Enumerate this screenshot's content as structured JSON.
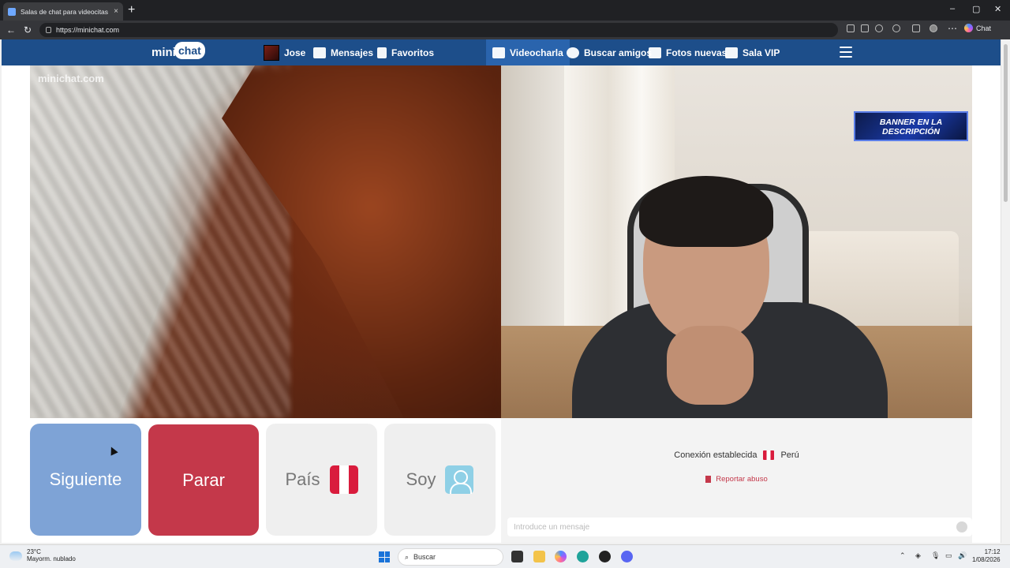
{
  "browser": {
    "tab_title": "Salas de chat para videocitas",
    "tab_close": "×",
    "new_tab": "+",
    "url": "https://minichat.com",
    "chat_button": "Chat",
    "window_controls": [
      "–",
      "▢",
      "✕"
    ]
  },
  "site": {
    "logo_mini": "mini",
    "logo_chat": "chat",
    "nav": {
      "user_name": "Jose",
      "messages": "Mensajes",
      "favorites": "Favoritos",
      "videochat": "Videocharla",
      "find_friends": "Buscar amigos",
      "new_photos": "Fotos nuevas",
      "vip_room": "Sala VIP"
    },
    "watermark": "minichat.com",
    "banner": "BANNER EN LA DESCRIPCIÓN"
  },
  "controls": {
    "next": "Siguiente",
    "stop": "Parar",
    "country": "País",
    "gender": "Soy"
  },
  "chat": {
    "status": "Conexión establecida",
    "country": "Perú",
    "report": "Reportar abuso",
    "message_placeholder": "Introduce un mensaje"
  },
  "taskbar": {
    "temperature": "23°C",
    "weather": "Mayorm. nublado",
    "search": "Buscar",
    "time": "17:12",
    "date": "1/08/2026"
  },
  "colors": {
    "nav_bg": "#1d4e8a",
    "next_btn": "#7ea3d6",
    "stop_btn": "#c4384a",
    "peru_red": "#d91c3d"
  }
}
